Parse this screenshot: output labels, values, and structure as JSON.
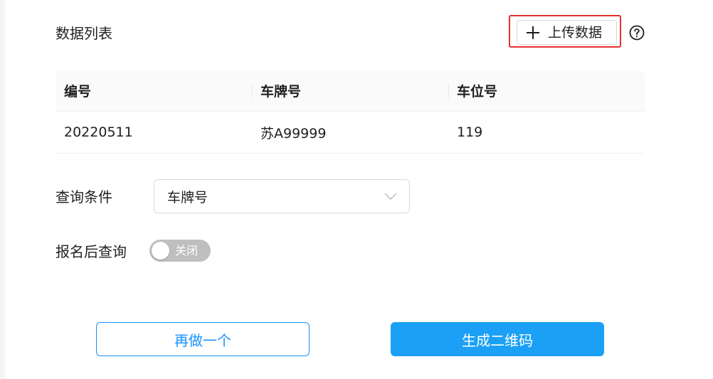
{
  "colors": {
    "accent": "#1890ff",
    "primary_button": "#1ba0f5",
    "highlight_border": "#e5312f",
    "toggle_off": "#bfbfbf"
  },
  "header": {
    "title": "数据列表",
    "upload_label": "上传数据",
    "upload_icon": "plus-icon",
    "help_icon": "question-circle-icon"
  },
  "table": {
    "columns": [
      "编号",
      "车牌号",
      "车位号"
    ],
    "rows": [
      [
        "20220511",
        "苏A99999",
        "119"
      ]
    ]
  },
  "form": {
    "query_label": "查询条件",
    "query_select_value": "车牌号",
    "after_signup_label": "报名后查询",
    "toggle_state_text": "关闭",
    "toggle_on": false
  },
  "actions": {
    "redo_label": "再做一个",
    "generate_label": "生成二维码"
  }
}
